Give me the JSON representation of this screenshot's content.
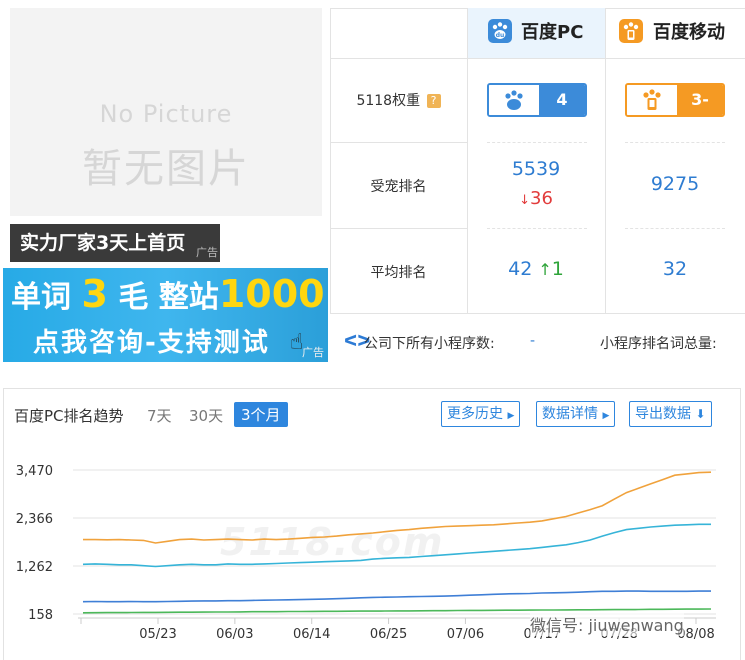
{
  "left": {
    "nopic_en": "No Picture",
    "nopic_cn": "暂无图片",
    "ad1_text": "实力厂家3天上首页",
    "ad_tag": "广告",
    "ad2_line1_a": "单词",
    "ad2_line1_b": "3",
    "ad2_line1_c": "毛  整站",
    "ad2_line1_d": "1000",
    "ad2_line2": "点我咨询-支持测试"
  },
  "table": {
    "col_pc": "百度PC",
    "col_mobile": "百度移动",
    "row_weight_label": "5118权重",
    "row_weight_help": "?",
    "pc_weight": "4",
    "mobile_weight": "3-",
    "row_fav_label": "受宠排名",
    "pc_fav": "5539",
    "pc_fav_change_arrow": "↓",
    "pc_fav_change": "36",
    "mobile_fav": "9275",
    "row_avg_label": "平均排名",
    "pc_avg": "42",
    "pc_avg_change_arrow": "↑",
    "pc_avg_change": "1",
    "mobile_avg": "32",
    "brand_pc_color": "#3c8bd9",
    "brand_mobile_color": "#f59a23"
  },
  "bottombar": {
    "mini_count_label": "公司下所有小程序数:",
    "mini_count_value": "-",
    "mini_rank_label": "小程序排名词总量:"
  },
  "chart_panel": {
    "title": "百度PC排名趋势",
    "range_7": "7天",
    "range_30": "30天",
    "range_3m": "3个月",
    "btn_history": "更多历史",
    "btn_detail": "数据详情",
    "btn_export": "导出数据",
    "watermark": "5118.com",
    "wechat": "微信号: jiuwenwang"
  },
  "chart_data": {
    "type": "line",
    "y_ticks": [
      "3,470",
      "2,366",
      "1,262",
      "158"
    ],
    "x_ticks": [
      "05/23",
      "06/03",
      "06/14",
      "06/25",
      "07/06",
      "07/17",
      "07/28",
      "08/08"
    ],
    "ylim": [
      158,
      3470
    ],
    "series": [
      {
        "color": "#f0a23c",
        "values": [
          1870,
          1870,
          1865,
          1870,
          1860,
          1850,
          1790,
          1830,
          1870,
          1880,
          1860,
          1870,
          1880,
          1870,
          1860,
          1880,
          1870,
          1880,
          1900,
          1920,
          1930,
          1950,
          1980,
          2000,
          2020,
          2050,
          2080,
          2100,
          2130,
          2150,
          2170,
          2180,
          2190,
          2200,
          2210,
          2230,
          2250,
          2270,
          2300,
          2350,
          2400,
          2480,
          2560,
          2650,
          2800,
          2950,
          3050,
          3150,
          3250,
          3350,
          3380,
          3410,
          3420
        ]
      },
      {
        "color": "#36b4d8",
        "values": [
          1300,
          1310,
          1300,
          1290,
          1290,
          1270,
          1250,
          1270,
          1290,
          1300,
          1290,
          1290,
          1310,
          1300,
          1300,
          1310,
          1320,
          1330,
          1340,
          1350,
          1360,
          1370,
          1380,
          1390,
          1420,
          1440,
          1450,
          1460,
          1480,
          1500,
          1520,
          1540,
          1560,
          1580,
          1600,
          1620,
          1640,
          1660,
          1690,
          1720,
          1750,
          1800,
          1860,
          1950,
          2030,
          2100,
          2130,
          2160,
          2180,
          2200,
          2210,
          2220,
          2220
        ]
      },
      {
        "color": "#3f7fd6",
        "values": [
          440,
          445,
          440,
          440,
          445,
          440,
          440,
          445,
          450,
          455,
          460,
          460,
          465,
          465,
          470,
          475,
          480,
          485,
          490,
          495,
          500,
          510,
          520,
          530,
          540,
          545,
          550,
          555,
          560,
          565,
          570,
          580,
          590,
          600,
          610,
          620,
          625,
          630,
          640,
          645,
          650,
          660,
          670,
          680,
          680,
          685,
          685,
          680,
          680,
          680,
          680,
          685,
          685
        ]
      },
      {
        "color": "#4cb85a",
        "values": [
          185,
          188,
          190,
          190,
          192,
          195,
          195,
          197,
          200,
          200,
          202,
          205,
          205,
          207,
          210,
          210,
          212,
          215,
          215,
          218,
          220,
          220,
          222,
          225,
          225,
          228,
          230,
          230,
          232,
          235,
          235,
          238,
          240,
          240,
          242,
          245,
          245,
          248,
          250,
          250,
          252,
          255,
          255,
          258,
          260,
          260,
          262,
          265,
          265,
          268,
          270,
          270,
          272
        ]
      }
    ]
  }
}
